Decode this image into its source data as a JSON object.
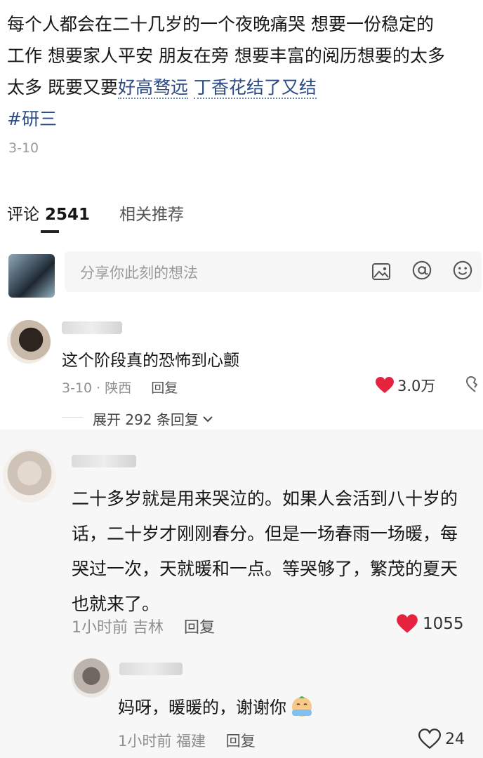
{
  "post": {
    "line1": "每个人都会在二十几岁的一个夜晚痛哭 想要一份稳定的",
    "line2": "工作 想要家人平安 朋友在旁 想要丰富的阅历想要的太多",
    "line3_prefix": "太多 既要又要",
    "link1": "好高骛远",
    "link2": "丁香花结了又结",
    "hashtag": "#研三",
    "date": "3-10"
  },
  "tabs": {
    "comments_label": "评论",
    "comments_count": "2541",
    "related": "相关推荐"
  },
  "input": {
    "placeholder": "分享你此刻的想法",
    "icons": [
      "image-icon",
      "at-icon",
      "emoji-icon"
    ]
  },
  "comments": [
    {
      "text": "这个阶段真的恐怖到心颤",
      "date": "3-10 · 陕西",
      "reply": "回复",
      "likes": "3.0万",
      "expand": "展开 292 条回复"
    },
    {
      "text": "二十多岁就是用来哭泣的。如果人会活到八十岁的话，二十岁才刚刚春分。但是一场春雨一场暖，每哭过一次，天就暖和一点。等哭够了，繁茂的夏天也就来了。",
      "time": "1小时前 吉林",
      "reply": "回复",
      "likes": "1055"
    },
    {
      "text": "妈呀，暖暖的，谢谢你",
      "time": "1小时前 福建",
      "reply": "回复",
      "likes": "24"
    }
  ],
  "colors": {
    "link": "#2b4a86",
    "like_red": "#e5233f",
    "meta_gray": "#8f8f8f"
  }
}
